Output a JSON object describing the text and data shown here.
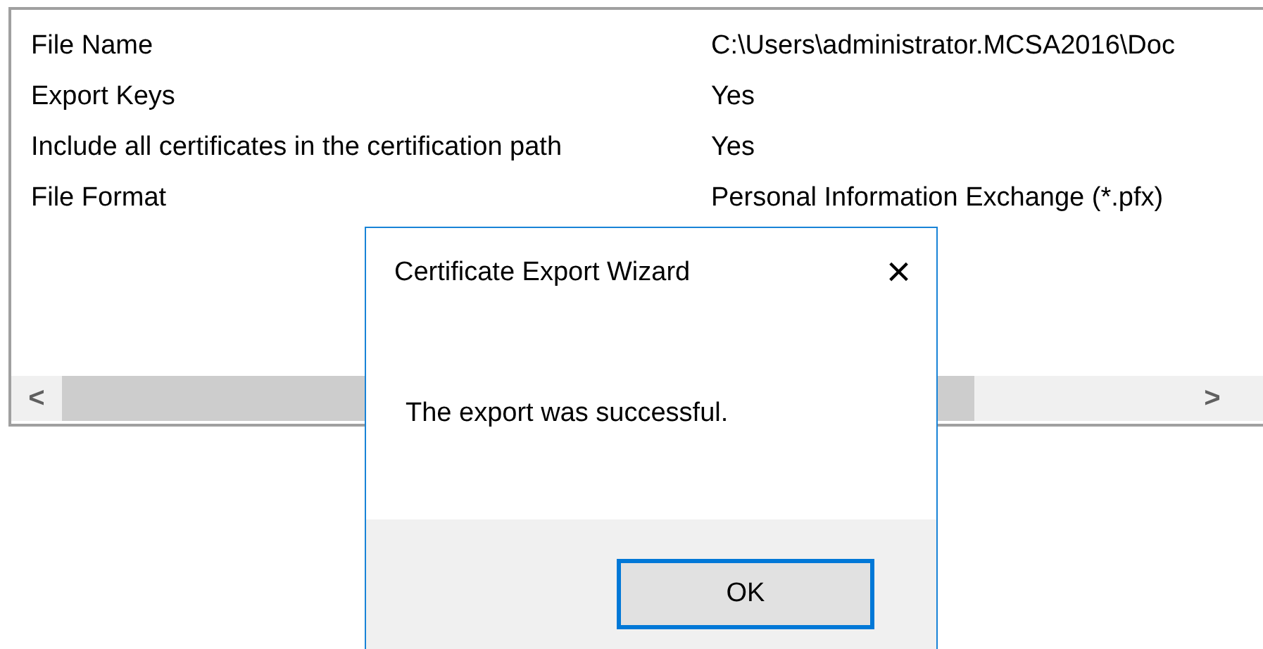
{
  "summary": {
    "rows": [
      {
        "label": "File Name",
        "value": "C:\\Users\\administrator.MCSA2016\\Doc"
      },
      {
        "label": "Export Keys",
        "value": "Yes"
      },
      {
        "label": "Include all certificates in the certification path",
        "value": "Yes"
      },
      {
        "label": "File Format",
        "value": "Personal Information Exchange (*.pfx)"
      }
    ],
    "scroll_left": "<",
    "scroll_right": ">"
  },
  "dialog": {
    "title": "Certificate Export Wizard",
    "close": "×",
    "message": "The export was successful.",
    "buttons": [
      {
        "label": "OK",
        "default": true
      }
    ]
  }
}
